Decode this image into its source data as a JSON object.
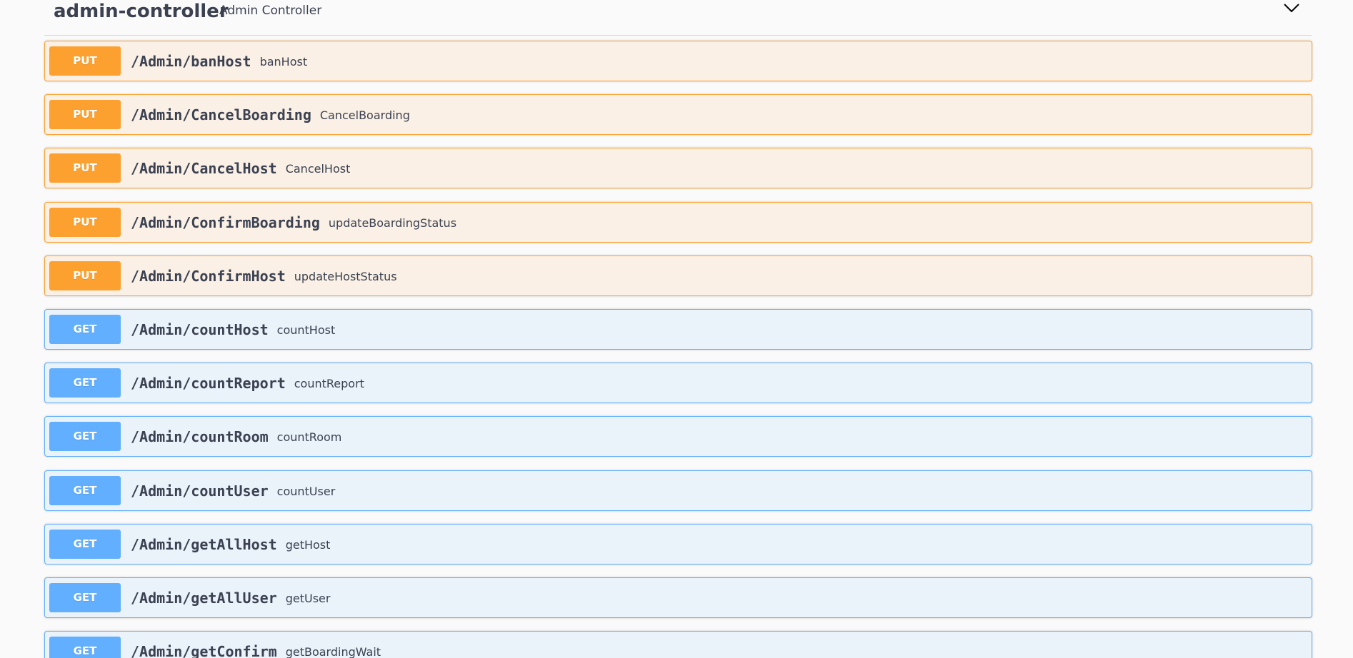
{
  "tag": {
    "name": "admin-controller",
    "description": "Admin Controller",
    "toggle_icon": "chevron-down-icon"
  },
  "operations": [
    {
      "method": "PUT",
      "path": "/Admin/banHost",
      "summary": "banHost"
    },
    {
      "method": "PUT",
      "path": "/Admin/CancelBoarding",
      "summary": "CancelBoarding"
    },
    {
      "method": "PUT",
      "path": "/Admin/CancelHost",
      "summary": "CancelHost"
    },
    {
      "method": "PUT",
      "path": "/Admin/ConfirmBoarding",
      "summary": "updateBoardingStatus"
    },
    {
      "method": "PUT",
      "path": "/Admin/ConfirmHost",
      "summary": "updateHostStatus"
    },
    {
      "method": "GET",
      "path": "/Admin/countHost",
      "summary": "countHost"
    },
    {
      "method": "GET",
      "path": "/Admin/countReport",
      "summary": "countReport"
    },
    {
      "method": "GET",
      "path": "/Admin/countRoom",
      "summary": "countRoom"
    },
    {
      "method": "GET",
      "path": "/Admin/countUser",
      "summary": "countUser"
    },
    {
      "method": "GET",
      "path": "/Admin/getAllHost",
      "summary": "getHost"
    },
    {
      "method": "GET",
      "path": "/Admin/getAllUser",
      "summary": "getUser"
    },
    {
      "method": "GET",
      "path": "/Admin/getConfirm",
      "summary": "getBoardingWait"
    }
  ],
  "colors": {
    "put": "#fca130",
    "get": "#61affe",
    "text": "#3b4151",
    "background": "#fafafa"
  }
}
